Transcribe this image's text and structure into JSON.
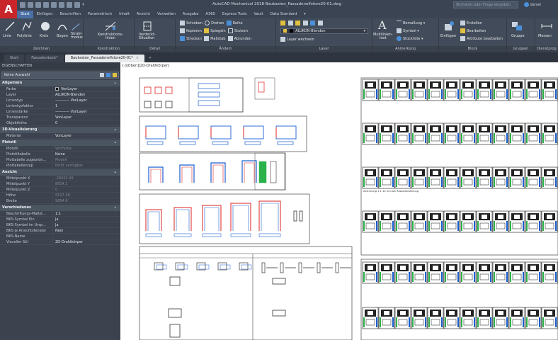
{
  "app": {
    "logo_letter": "A",
    "title": "AutoCAD Mechanical 2018   Baukasten_Fassadenelfstore20-01.dwg",
    "search_placeholder": "Stichwort oder Frage eingeben",
    "user": "daniel"
  },
  "ribbon_tabs": [
    {
      "label": "Start",
      "active": true
    },
    {
      "label": "Einfügen",
      "active": false
    },
    {
      "label": "Beschriften",
      "active": false
    },
    {
      "label": "Parametrisch",
      "active": false
    },
    {
      "label": "Inhalt",
      "active": false
    },
    {
      "label": "Ansicht",
      "active": false
    },
    {
      "label": "Verwalten",
      "active": false
    },
    {
      "label": "Ausgabe",
      "active": false
    },
    {
      "label": "A360",
      "active": false
    },
    {
      "label": "Express Tools",
      "active": false
    },
    {
      "label": "Vault",
      "active": false
    },
    {
      "label": "Data Standard",
      "active": false
    }
  ],
  "ribbon": {
    "zeichnen": {
      "label": "Zeichnen",
      "linie": "Linie",
      "polylinie": "Polylinie",
      "kreis": "Kreis",
      "bogen": "Bogen",
      "strahl": "Strahl-\nmodus"
    },
    "konstruktion": {
      "label": "Konstruktion",
      "button": "Konstruktions-\nlinien"
    },
    "detail": {
      "label": "Detail",
      "verdeckt": "Verdeckt-\nSituation"
    },
    "aendern": {
      "label": "Ändern",
      "row1": [
        "Schieben",
        "Drehen",
        "Reihe"
      ],
      "row2": [
        "Kopieren",
        "Spiegeln",
        "Stutzen"
      ],
      "row3": [
        "Strecken",
        "Maßstab",
        "Abrunden"
      ]
    },
    "layer": {
      "label": "Layer",
      "current": "ALUKON-Blenden",
      "action": "Layer wechseln"
    },
    "anmerkung": {
      "label": "Anmerkung",
      "text": "Multilinien-\ntext",
      "bemassung": "Bemaßung",
      "symbol": "Symbol",
      "stuckliste": "Stückliste"
    },
    "block": {
      "label": "Block",
      "einfuegen": "Einfügen",
      "erstellen": "Erstellen",
      "bearbeiten": "Bearbeiten",
      "attribute": "Attribute bearbeiten"
    },
    "gruppen": {
      "label": "Gruppen",
      "button": "Gruppe"
    },
    "dienstprog": {
      "label": "Dienstprog",
      "button": "Messen"
    }
  },
  "doc_tabs": [
    {
      "label": "Start",
      "active": false
    },
    {
      "label": "Fassadenbock*",
      "active": false
    },
    {
      "label": "Baukasten_Fassadenelfstore20-01*",
      "active": true
    }
  ],
  "viewport_label": "[-][Oben][2D-Drahtkörper]",
  "properties": {
    "title": "EIGENSCHAFTEN",
    "selection": "Keine Auswahl",
    "sections": [
      {
        "name": "Allgemein",
        "rows": [
          {
            "k": "Farbe",
            "v": "VonLayer",
            "swatch": true
          },
          {
            "k": "Layer",
            "v": "ALUKON-Blenden"
          },
          {
            "k": "Linientyp",
            "v": "———— VonLayer"
          },
          {
            "k": "Linientypfaktor",
            "v": "1"
          },
          {
            "k": "Linienstärke",
            "v": "———— VonLayer"
          },
          {
            "k": "Transparenz",
            "v": "VonLayer"
          },
          {
            "k": "Objekthöhe",
            "v": "0"
          }
        ]
      },
      {
        "name": "3D-Visualisierung",
        "rows": [
          {
            "k": "Material",
            "v": "VonLayer"
          }
        ]
      },
      {
        "name": "Plotstil",
        "rows": [
          {
            "k": "Plotstil",
            "v": "VonFarbe",
            "dim": true
          },
          {
            "k": "Plotstiltabelle",
            "v": "Keine"
          },
          {
            "k": "Plottabelle zugeordn...",
            "v": "Modell",
            "dim": true
          },
          {
            "k": "Plottabellentyp",
            "v": "Nicht verfügbar",
            "dim": true
          }
        ]
      },
      {
        "name": "Ansicht",
        "rows": [
          {
            "k": "Mittelpunkt X",
            "v": "-28202.99",
            "dim": true
          },
          {
            "k": "Mittelpunkt Y",
            "v": "8814.1",
            "dim": true
          },
          {
            "k": "Mittelpunkt Z",
            "v": "0",
            "dim": true
          },
          {
            "k": "Höhe",
            "v": "5517.38",
            "dim": true
          },
          {
            "k": "Breite",
            "v": "9854.6",
            "dim": true
          }
        ]
      },
      {
        "name": "Verschiedenes",
        "rows": [
          {
            "k": "Beschriftungs-Maßst...",
            "v": "1:1"
          },
          {
            "k": "BKS-Symbol Ein",
            "v": "Ja"
          },
          {
            "k": "BKS-Symbol im Ursp...",
            "v": "Ja"
          },
          {
            "k": "BKS je Ansichtsfenster",
            "v": "Nein"
          },
          {
            "k": "BKS-Name",
            "v": ""
          },
          {
            "k": "Visueller Stil",
            "v": "2D-Drahtkörper"
          }
        ]
      }
    ]
  },
  "canvas": {
    "table_note": "Zeichnung 1:1 10 mm bei Fassadenstörung"
  },
  "colors": {
    "titlebar": "#3b4453",
    "ribbon": "#424b59",
    "panel": "#3c434e",
    "accent": "#4a6fa5",
    "logo": "#c8262a",
    "canvas": "#ffffff",
    "drawing_blue": "#1a5fd0",
    "drawing_red": "#d22",
    "drawing_green": "#2bb24a"
  }
}
